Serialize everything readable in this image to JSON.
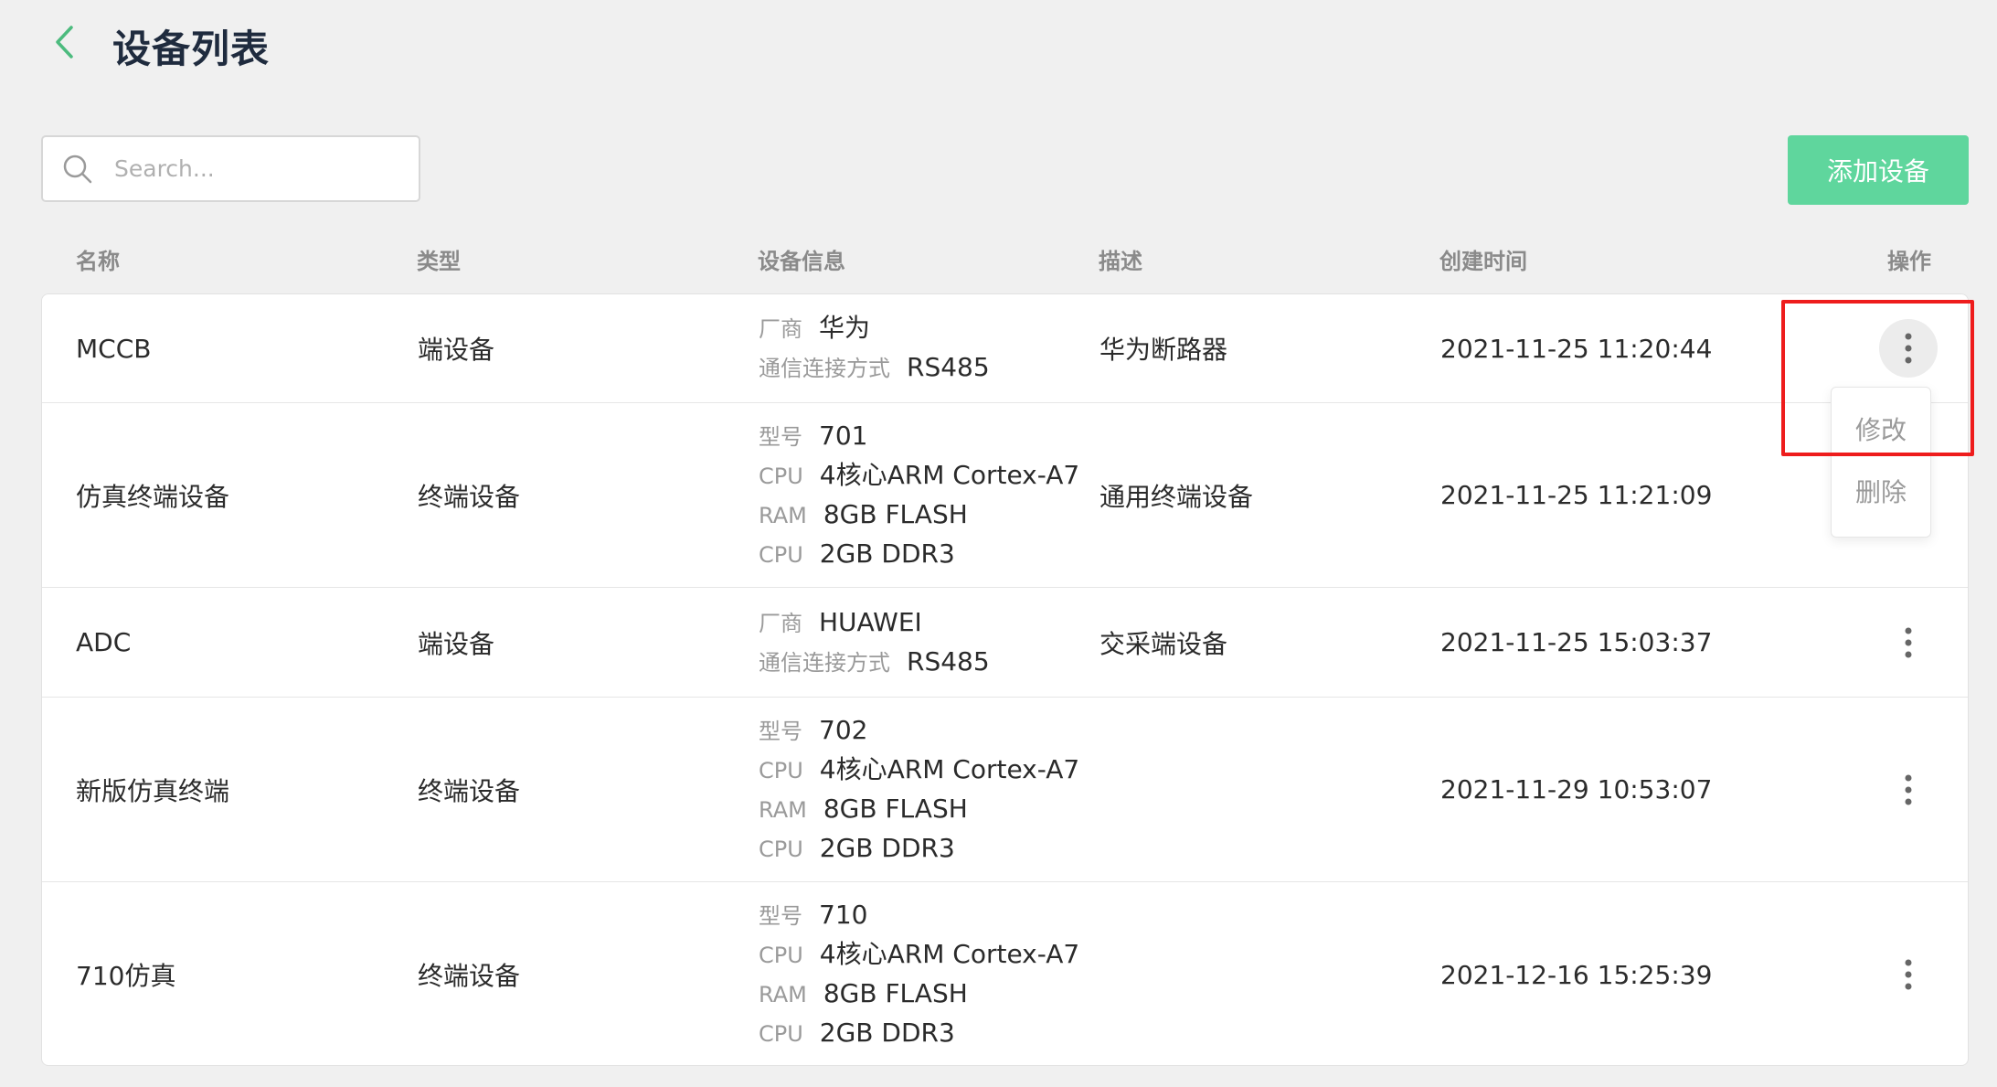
{
  "header": {
    "title": "设备列表"
  },
  "search": {
    "placeholder": "Search..."
  },
  "toolbar": {
    "add_label": "添加设备"
  },
  "columns": [
    "名称",
    "类型",
    "设备信息",
    "描述",
    "创建时间",
    "操作"
  ],
  "rows": [
    {
      "name": "MCCB",
      "type": "端设备",
      "info": [
        {
          "key": "厂商",
          "value": "华为"
        },
        {
          "key": "通信连接方式",
          "value": "RS485"
        }
      ],
      "desc": "华为断路器",
      "created": "2021-11-25 11:20:44"
    },
    {
      "name": "仿真终端设备",
      "type": "终端设备",
      "info": [
        {
          "key": "型号",
          "value": "701"
        },
        {
          "key": "CPU",
          "value": "4核心ARM Cortex-A7"
        },
        {
          "key": "RAM",
          "value": "8GB FLASH"
        },
        {
          "key": "CPU",
          "value": "2GB DDR3"
        }
      ],
      "desc": "通用终端设备",
      "created": "2021-11-25 11:21:09"
    },
    {
      "name": "ADC",
      "type": "端设备",
      "info": [
        {
          "key": "厂商",
          "value": "HUAWEI"
        },
        {
          "key": "通信连接方式",
          "value": "RS485"
        }
      ],
      "desc": "交采端设备",
      "created": "2021-11-25 15:03:37"
    },
    {
      "name": "新版仿真终端",
      "type": "终端设备",
      "info": [
        {
          "key": "型号",
          "value": "702"
        },
        {
          "key": "CPU",
          "value": "4核心ARM Cortex-A7"
        },
        {
          "key": "RAM",
          "value": "8GB FLASH"
        },
        {
          "key": "CPU",
          "value": "2GB DDR3"
        }
      ],
      "desc": "",
      "created": "2021-11-29 10:53:07"
    },
    {
      "name": "710仿真",
      "type": "终端设备",
      "info": [
        {
          "key": "型号",
          "value": "710"
        },
        {
          "key": "CPU",
          "value": "4核心ARM Cortex-A7"
        },
        {
          "key": "RAM",
          "value": "8GB FLASH"
        },
        {
          "key": "CPU",
          "value": "2GB DDR3"
        }
      ],
      "desc": "",
      "created": "2021-12-16 15:25:39"
    }
  ],
  "popup_menu": {
    "edit_label": "修改",
    "delete_label": "删除"
  },
  "colors": {
    "accent": "#5fd69d",
    "back_arrow": "#4cbb7e",
    "highlight_box": "#ee1c1c"
  }
}
